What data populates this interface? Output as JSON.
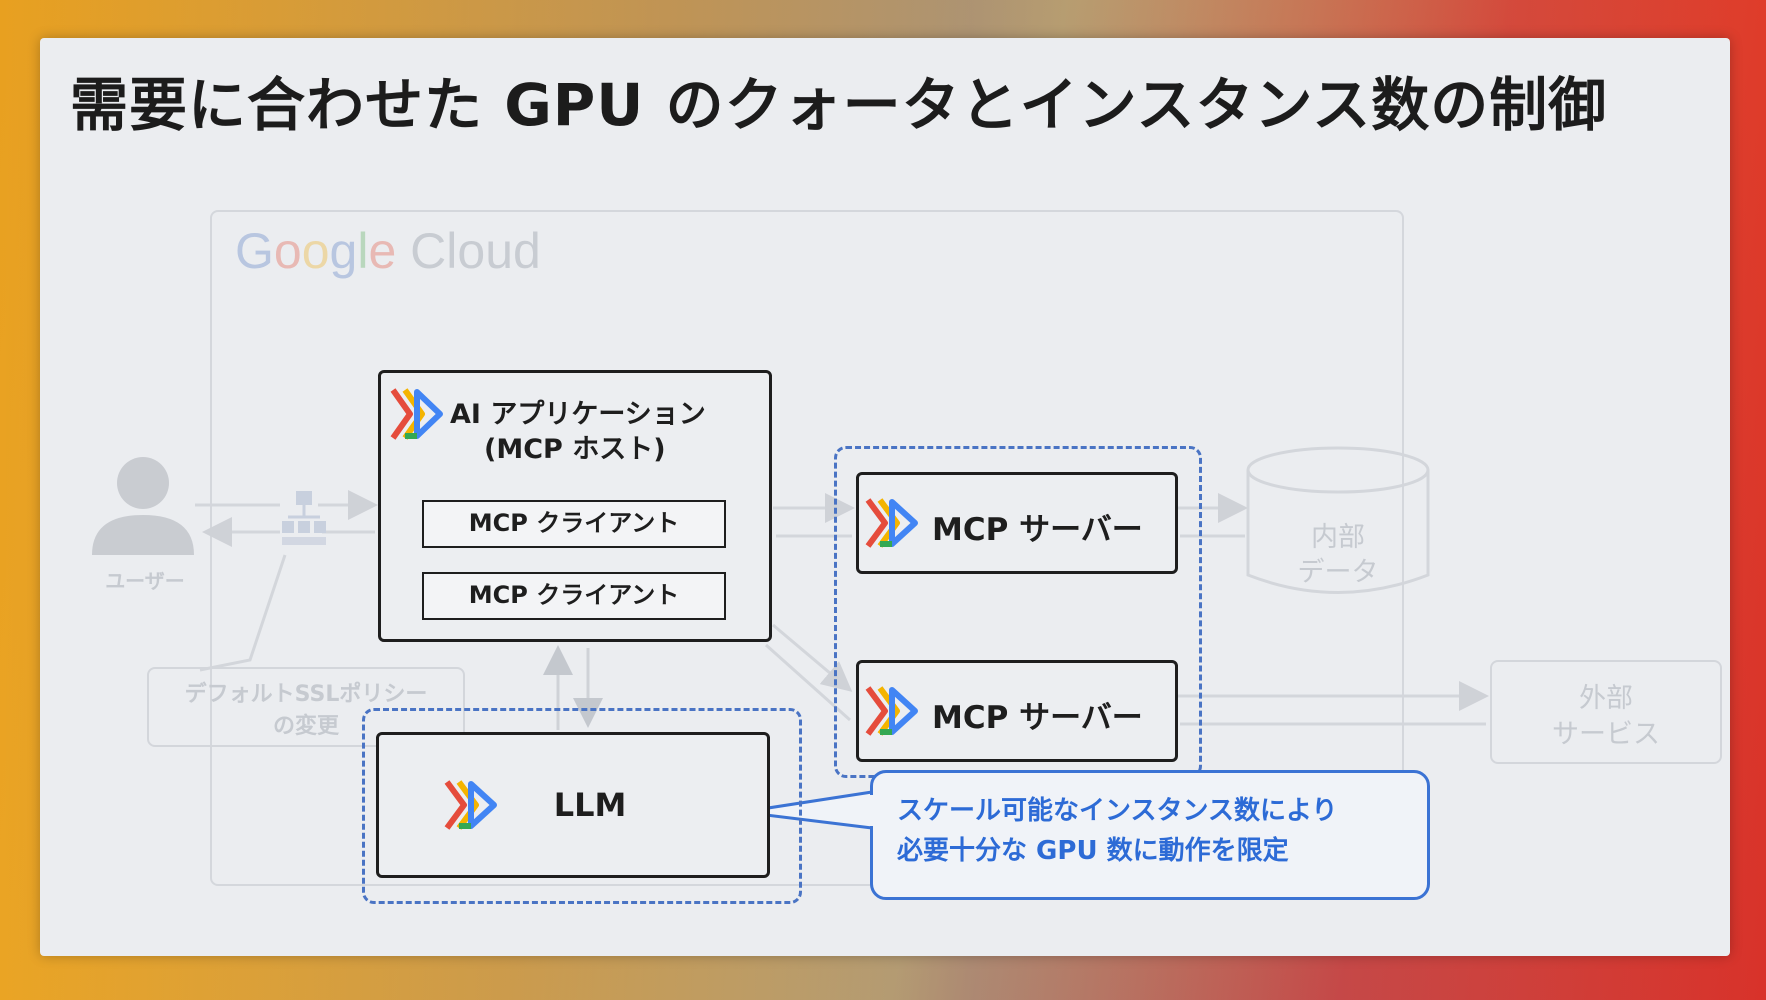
{
  "title": "需要に合わせた GPU のクォータとインスタンス数の制御",
  "cloud_logo": {
    "google": [
      "G",
      "o",
      "o",
      "g",
      "l",
      "e"
    ],
    "cloud": "Cloud"
  },
  "user": {
    "label": "ユーザー"
  },
  "ssl_note": {
    "line1": "デフォルトSSLポリシー",
    "line2": "の変更"
  },
  "ai_app": {
    "line1": "AI アプリケーション",
    "line2": "(MCP ホスト)",
    "clients": [
      "MCP クライアント",
      "MCP クライアント"
    ]
  },
  "mcp_servers": [
    "MCP サーバー",
    "MCP サーバー"
  ],
  "internal_data": {
    "line1": "内部",
    "line2": "データ"
  },
  "external_service": {
    "line1": "外部",
    "line2": "サービス"
  },
  "llm": {
    "label": "LLM"
  },
  "callout": {
    "line1": "スケール可能なインスタンス数により",
    "line2": "必要十分な GPU 数に動作を限定"
  },
  "colors": {
    "dashed_border": "#4a74c4",
    "callout_text": "#2d6bd6",
    "run_icon": [
      "#e54c3c",
      "#f4b400",
      "#34a853",
      "#4285f4"
    ]
  }
}
